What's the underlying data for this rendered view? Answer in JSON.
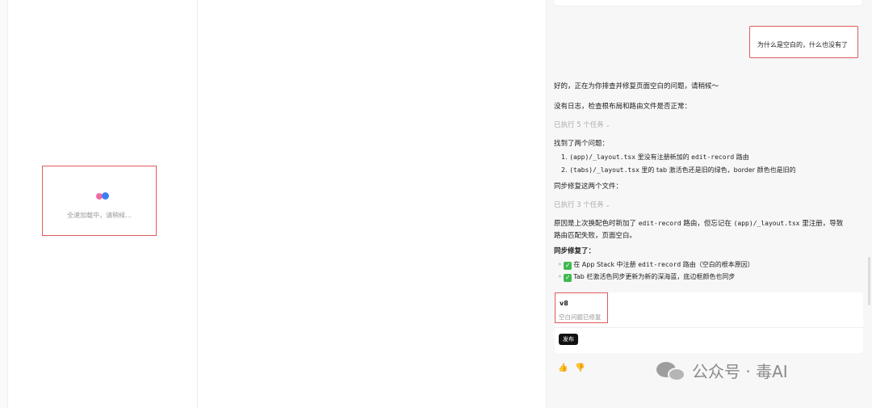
{
  "preview": {
    "loading_text": "全速加载中，请稍候..."
  },
  "chat": {
    "user_message": "为什么是空白的，什么也没有了",
    "reply_intro": "好的，正在为你排查并修复页面空白的问题，请稍候～",
    "no_logs": "没有日志，检查根布局和路由文件是否正常：",
    "executed_5": "已执行 5 个任务",
    "found_two": "找到了两个问题：",
    "issue_1_num": "1.",
    "issue_1_code": "(app)/_layout.tsx",
    "issue_1_a": " 里没有注册新加的 ",
    "issue_1_code2": "edit-record",
    "issue_1_b": " 路由",
    "issue_2_num": "2.",
    "issue_2_code": "(tabs)/_layout.tsx",
    "issue_2_a": " 里的 tab 激活色还是旧的绿色，border 颜色也是旧的",
    "sync_fix": "同步修复这两个文件：",
    "executed_3": "已执行 3 个任务",
    "cause_a": "原因是上次换配色时新加了 ",
    "cause_code": "edit-record",
    "cause_b": " 路由，但忘记在 ",
    "cause_code2": "(app)/_layout.tsx",
    "cause_c": " 里注册，导致",
    "cause_line2": "路由匹配失败，页面空白。",
    "fixed_heading": "同步修复了：",
    "fix_1_a": "在 App Stack 中注册 ",
    "fix_1_code": "edit-record",
    "fix_1_b": " 路由（空白的根本原因）",
    "fix_2": "Tab 栏激活色同步更新为新的深海蓝，底边框颜色也同步",
    "check_glyph": "✓"
  },
  "version": {
    "title": "v8",
    "description": "空白问题已修复",
    "publish_label": "发布"
  },
  "feedback": {
    "like_glyph": "👍",
    "dislike_glyph": "👎"
  },
  "watermark": {
    "text": "公众号 · 毒AI"
  },
  "colors": {
    "highlight_border": "#e05a5a",
    "check_green": "#3fb94f",
    "dot_pink": "#f06aa8",
    "dot_blue": "#3f7ef0"
  }
}
